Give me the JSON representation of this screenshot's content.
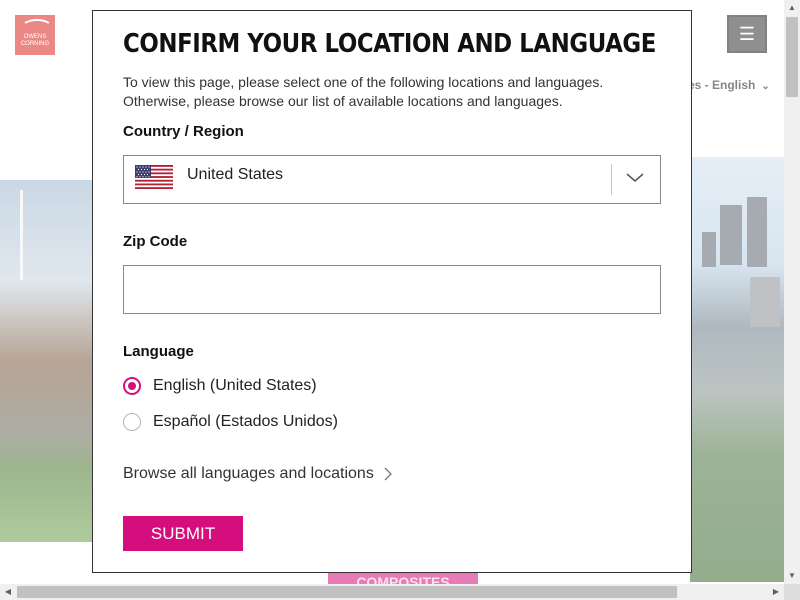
{
  "background": {
    "logo_line1": "OWENS",
    "logo_line2": "CORNING",
    "language_selector": "es - English",
    "banner_button": "COMPOSITES",
    "accent_color": "#d40f7d",
    "logo_color": "#d9281f"
  },
  "modal": {
    "title": "CONFIRM YOUR LOCATION AND LANGUAGE",
    "desc_line1": "To view this page, please select one of the following locations and languages.",
    "desc_line2": "Otherwise, please browse our list of available locations and languages.",
    "country_label": "Country / Region",
    "country_value": "United States",
    "country_flag": "us-flag-icon",
    "zip_label": "Zip Code",
    "zip_value": "",
    "language_label": "Language",
    "languages": [
      {
        "label": "English (United States)",
        "selected": true
      },
      {
        "label": "Español (Estados Unidos)",
        "selected": false
      }
    ],
    "browse_link": "Browse all languages and locations",
    "submit_label": "SUBMIT"
  },
  "icons": {
    "menu": "hamburger-menu-icon",
    "dropdown": "chevron-down-icon",
    "browse": "chevron-right-icon"
  }
}
